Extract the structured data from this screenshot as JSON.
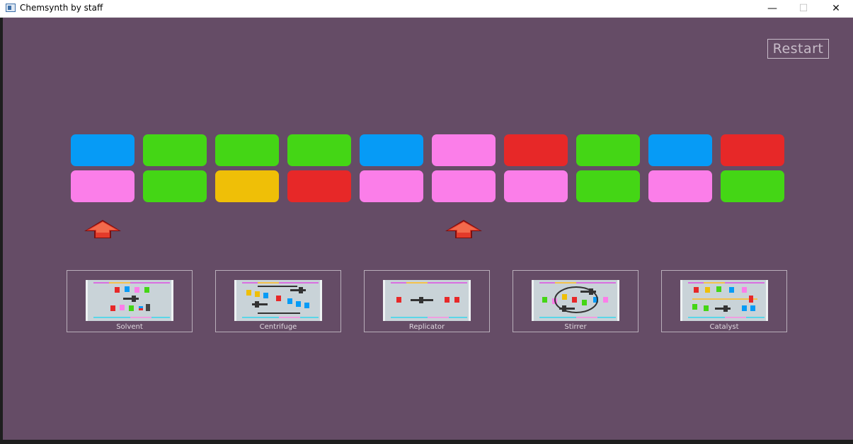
{
  "window": {
    "title": "Chemsynth by staff",
    "minimize_glyph": "—",
    "maximize_glyph": "☐",
    "close_glyph": "✕"
  },
  "restart_label": "Restart",
  "colors": {
    "blue": "#069bf6",
    "green": "#44d615",
    "pink": "#fb7ee9",
    "red": "#e72828",
    "yellow": "#efbf07",
    "background": "#654c66"
  },
  "grid": {
    "top_row": [
      "blue",
      "green",
      "green",
      "green",
      "blue",
      "pink",
      "red",
      "green",
      "blue",
      "red"
    ],
    "bottom_row": [
      "pink",
      "green",
      "yellow",
      "red",
      "pink",
      "pink",
      "pink",
      "green",
      "pink",
      "green"
    ]
  },
  "arrows": [
    {
      "column": 1,
      "icon": "red-up-arrow-icon"
    },
    {
      "column": 6,
      "icon": "red-up-arrow-icon"
    }
  ],
  "machines": [
    {
      "name": "Solvent"
    },
    {
      "name": "Centrifuge"
    },
    {
      "name": "Replicator"
    },
    {
      "name": "Stirrer"
    },
    {
      "name": "Catalyst"
    }
  ]
}
